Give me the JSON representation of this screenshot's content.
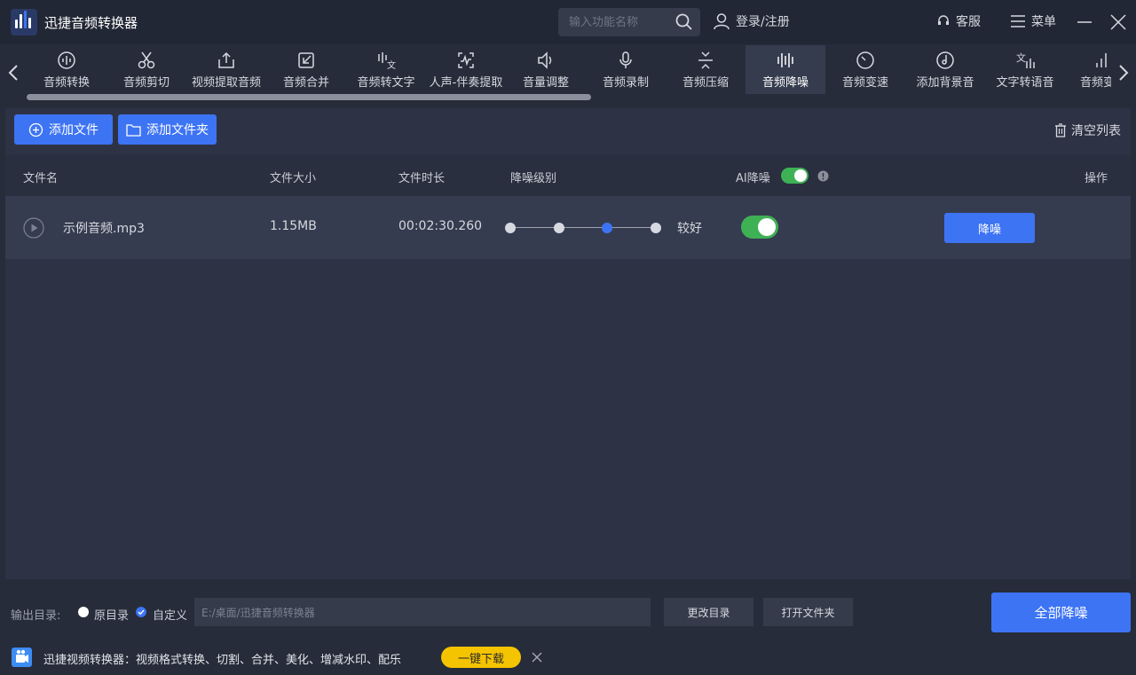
{
  "app": {
    "title": "迅捷音频转换器"
  },
  "search": {
    "placeholder": "输入功能名称"
  },
  "header": {
    "login": "登录/注册",
    "service": "客服",
    "menu": "菜单"
  },
  "toolbar": {
    "items": [
      {
        "label": "音频转换",
        "icon": "audio-convert-icon"
      },
      {
        "label": "音频剪切",
        "icon": "scissors-icon"
      },
      {
        "label": "视频提取音频",
        "icon": "upload-extract-icon"
      },
      {
        "label": "音频合并",
        "icon": "merge-icon"
      },
      {
        "label": "音频转文字",
        "icon": "speech-to-text-icon"
      },
      {
        "label": "人声-伴奏提取",
        "icon": "vocal-extract-icon"
      },
      {
        "label": "音量调整",
        "icon": "volume-icon"
      },
      {
        "label": "音频录制",
        "icon": "microphone-icon"
      },
      {
        "label": "音频压缩",
        "icon": "compress-icon"
      },
      {
        "label": "音频降噪",
        "icon": "denoise-icon",
        "active": true
      },
      {
        "label": "音频变速",
        "icon": "speed-icon"
      },
      {
        "label": "添加背景音",
        "icon": "background-music-icon"
      },
      {
        "label": "文字转语音",
        "icon": "text-to-speech-icon"
      },
      {
        "label": "音频变",
        "icon": "bars-icon"
      }
    ]
  },
  "actions": {
    "add_file": "添加文件",
    "add_folder": "添加文件夹",
    "clear_list": "清空列表"
  },
  "table": {
    "headers": {
      "name": "文件名",
      "size": "文件大小",
      "duration": "文件时长",
      "level": "降噪级别",
      "ai": "AI降噪",
      "op": "操作"
    },
    "rows": [
      {
        "name": "示例音频.mp3",
        "size": "1.15MB",
        "duration": "00:02:30.260",
        "level_index": 3,
        "level_count": 4,
        "level_label": "较好",
        "ai_on": true,
        "action": "降噪"
      }
    ]
  },
  "output": {
    "label": "输出目录:",
    "original": "原目录",
    "custom": "自定义",
    "selected": "custom",
    "path": "E:/桌面/迅捷音频转换器",
    "change": "更改目录",
    "open": "打开文件夹"
  },
  "primary": {
    "all": "全部降噪"
  },
  "promo": {
    "text": "迅捷视频转换器：视频格式转换、切割、合并、美化、增减水印、配乐",
    "download": "一键下载"
  },
  "colors": {
    "accent": "#3d74f4",
    "toggle_on": "#3fb155",
    "download_btn": "#f5c400",
    "background": "#272c3a"
  }
}
